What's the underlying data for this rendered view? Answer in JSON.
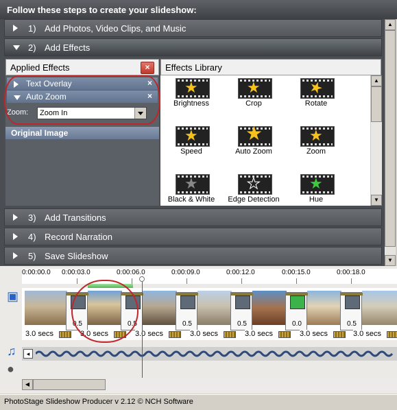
{
  "header": {
    "title": "Follow these steps to create your slideshow:"
  },
  "steps": [
    {
      "num": "1)",
      "label": "Add Photos, Video Clips, and Music",
      "state": "collapsed"
    },
    {
      "num": "2)",
      "label": "Add Effects",
      "state": "expanded"
    },
    {
      "num": "3)",
      "label": "Add Transitions",
      "state": "collapsed"
    },
    {
      "num": "4)",
      "label": "Record Narration",
      "state": "collapsed"
    },
    {
      "num": "5)",
      "label": "Save Slideshow",
      "state": "collapsed"
    }
  ],
  "applied": {
    "title": "Applied Effects",
    "close_icon": "×",
    "items": [
      {
        "label": "Text Overlay",
        "remove": "×"
      },
      {
        "label": "Auto Zoom",
        "remove": "×"
      }
    ],
    "zoom_label": "Zoom:",
    "zoom_value": "Zoom In",
    "original": "Original Image"
  },
  "library": {
    "title": "Effects Library",
    "items": [
      {
        "label": "Brightness",
        "icon": "star-brightness-icon"
      },
      {
        "label": "Crop",
        "icon": "star-crop-icon"
      },
      {
        "label": "Rotate",
        "icon": "star-rotate-icon"
      },
      {
        "label": "Speed",
        "icon": "star-speed-icon"
      },
      {
        "label": "Auto Zoom",
        "icon": "star-zoom-icon"
      },
      {
        "label": "Zoom",
        "icon": "star-zoom-icon"
      },
      {
        "label": "Black & White",
        "icon": "star-bw-icon"
      },
      {
        "label": "Edge Detection",
        "icon": "star-edge-icon"
      },
      {
        "label": "Hue",
        "icon": "star-hue-icon"
      }
    ]
  },
  "timeline": {
    "ticks": [
      "0:00:00.0",
      "0:00:03.0",
      "0:00:06.0",
      "0:00:09.0",
      "0:00:12.0",
      "0:00:15.0",
      "0:00:18.0"
    ],
    "clips": [
      {
        "secs": "3.0 secs"
      },
      {
        "secs": "3.0 secs"
      },
      {
        "secs": "3.0 secs"
      },
      {
        "secs": "3.0 secs"
      },
      {
        "secs": "3.0 secs"
      },
      {
        "secs": "3.0 secs"
      },
      {
        "secs": "3.0 secs"
      }
    ],
    "transitions": [
      "0.5",
      "0.5",
      "0.5",
      "0.5",
      "0.0",
      "0.5"
    ]
  },
  "status": {
    "text": "PhotoStage Slideshow Producer v 2.12 © NCH Software"
  },
  "colors": {
    "accent_red": "#c0252a",
    "step_bar": "#5c6166",
    "applied_row": "#6e7f9b"
  }
}
